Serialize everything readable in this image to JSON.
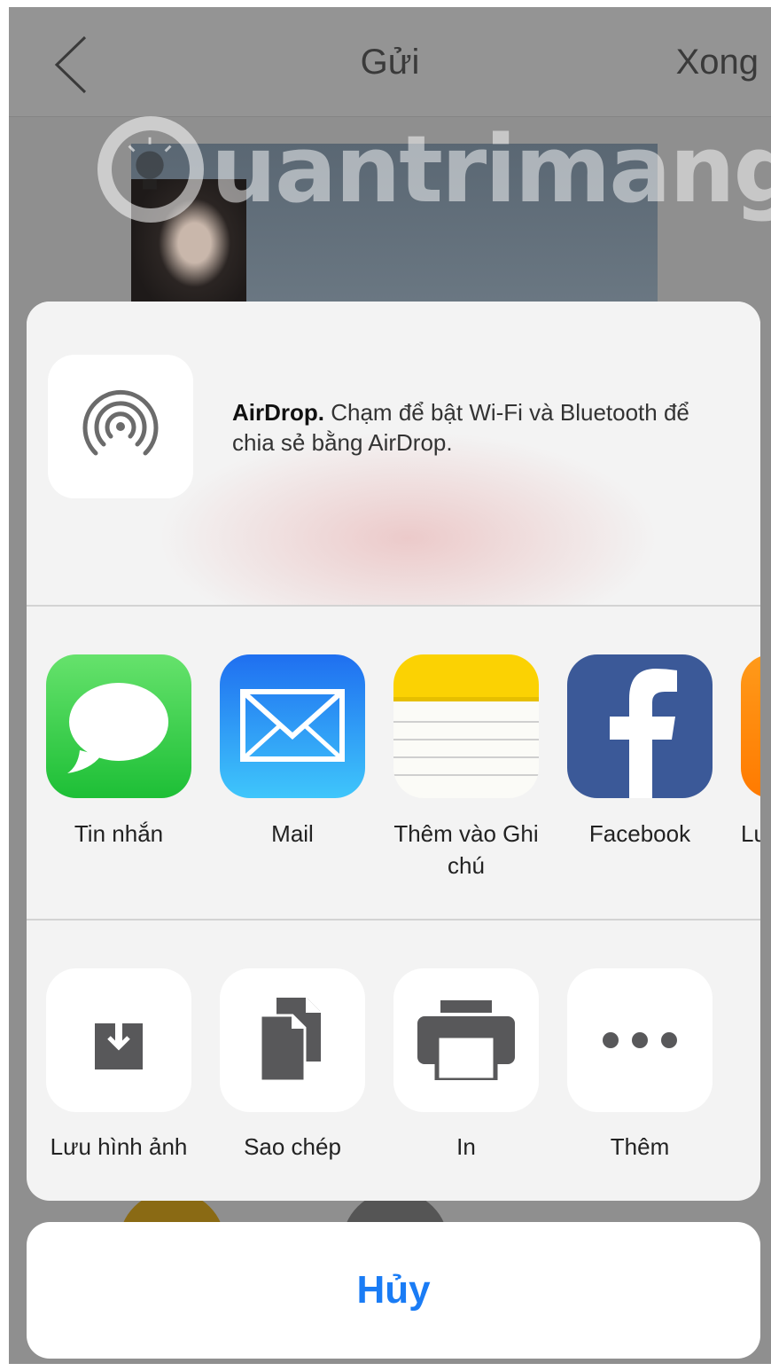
{
  "background": {
    "nav": {
      "back_icon": "chevron-left-icon",
      "title": "Gửi",
      "done_label": "Xong"
    },
    "watermark": "uantrimang"
  },
  "share_sheet": {
    "airdrop": {
      "icon": "airdrop-icon",
      "title": "AirDrop.",
      "description": "Chạm để bật Wi-Fi và Bluetooth để chia sẻ bằng AirDrop."
    },
    "apps": [
      {
        "icon": "messages-icon",
        "label": "Tin nhắn"
      },
      {
        "icon": "mail-icon",
        "label": "Mail"
      },
      {
        "icon": "notes-icon",
        "label": "Thêm vào Ghi chú"
      },
      {
        "icon": "facebook-icon",
        "label": "Facebook"
      },
      {
        "icon": "app-partial-icon",
        "label": "Lu"
      }
    ],
    "actions": [
      {
        "icon": "save-image-icon",
        "label": "Lưu hình ảnh"
      },
      {
        "icon": "copy-icon",
        "label": "Sao chép"
      },
      {
        "icon": "print-icon",
        "label": "In"
      },
      {
        "icon": "more-icon",
        "label": "Thêm"
      }
    ]
  },
  "cancel_label": "Hủy",
  "colors": {
    "accent": "#1a7cf5",
    "dim": "#8f8f8f",
    "sheet": "#f3f3f3"
  }
}
